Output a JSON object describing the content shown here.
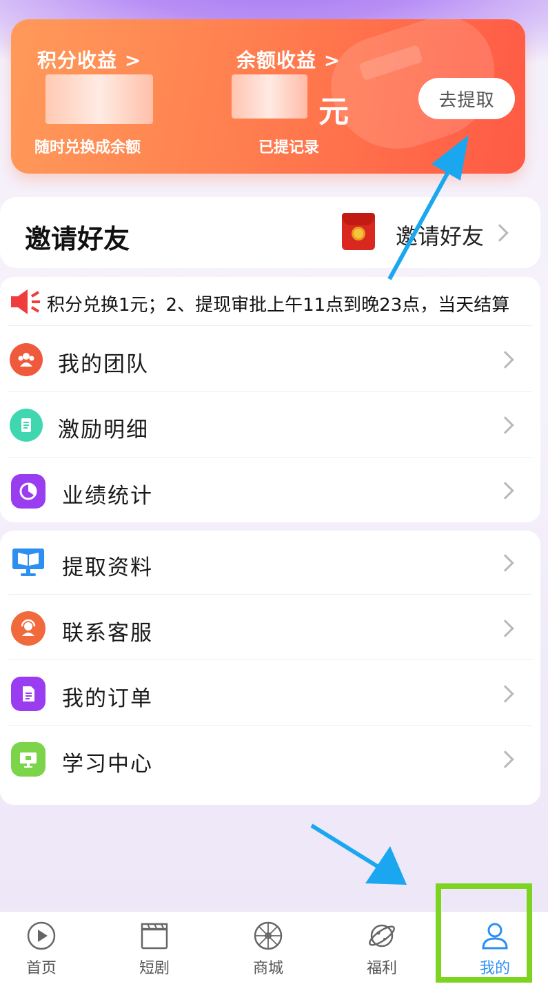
{
  "earnings": {
    "points_label": "积分收益 >",
    "balance_label": "余额收益 >",
    "currency_unit": "元",
    "withdraw_button": "去提取",
    "points_sub": "随时兑换成余额",
    "balance_sub": "已提记录"
  },
  "invite": {
    "title": "邀请好友",
    "action_label": "邀请好友"
  },
  "notice": {
    "text": "积分兑换1元；2、提现审批上午11点到晚23点，当天结算"
  },
  "menu_group_1": [
    {
      "label": "我的团队",
      "icon": "team-icon",
      "color": "#f05a3c"
    },
    {
      "label": "激励明细",
      "icon": "document-icon",
      "color": "#3fd6b0"
    },
    {
      "label": "业绩统计",
      "icon": "pie-chart-icon",
      "color": "#9a3cf0"
    }
  ],
  "menu_group_2": [
    {
      "label": "提取资料",
      "icon": "book-monitor-icon",
      "color": "#2d8ff0"
    },
    {
      "label": "联系客服",
      "icon": "customer-service-icon",
      "color": "#f06a3c"
    },
    {
      "label": "我的订单",
      "icon": "order-icon",
      "color": "#9a3cf0"
    },
    {
      "label": "学习中心",
      "icon": "screen-icon",
      "color": "#7cd44a"
    }
  ],
  "tabbar": [
    {
      "label": "首页",
      "icon": "play-circle-icon",
      "active": false
    },
    {
      "label": "短剧",
      "icon": "clapperboard-icon",
      "active": false
    },
    {
      "label": "商城",
      "icon": "wheel-icon",
      "active": false
    },
    {
      "label": "福利",
      "icon": "planet-icon",
      "active": false
    },
    {
      "label": "我的",
      "icon": "person-icon",
      "active": true
    }
  ],
  "colors": {
    "accent_active_tab": "#2b8ff2",
    "annotation_arrow": "#1aa7f0",
    "annotation_box": "#7cd420"
  }
}
